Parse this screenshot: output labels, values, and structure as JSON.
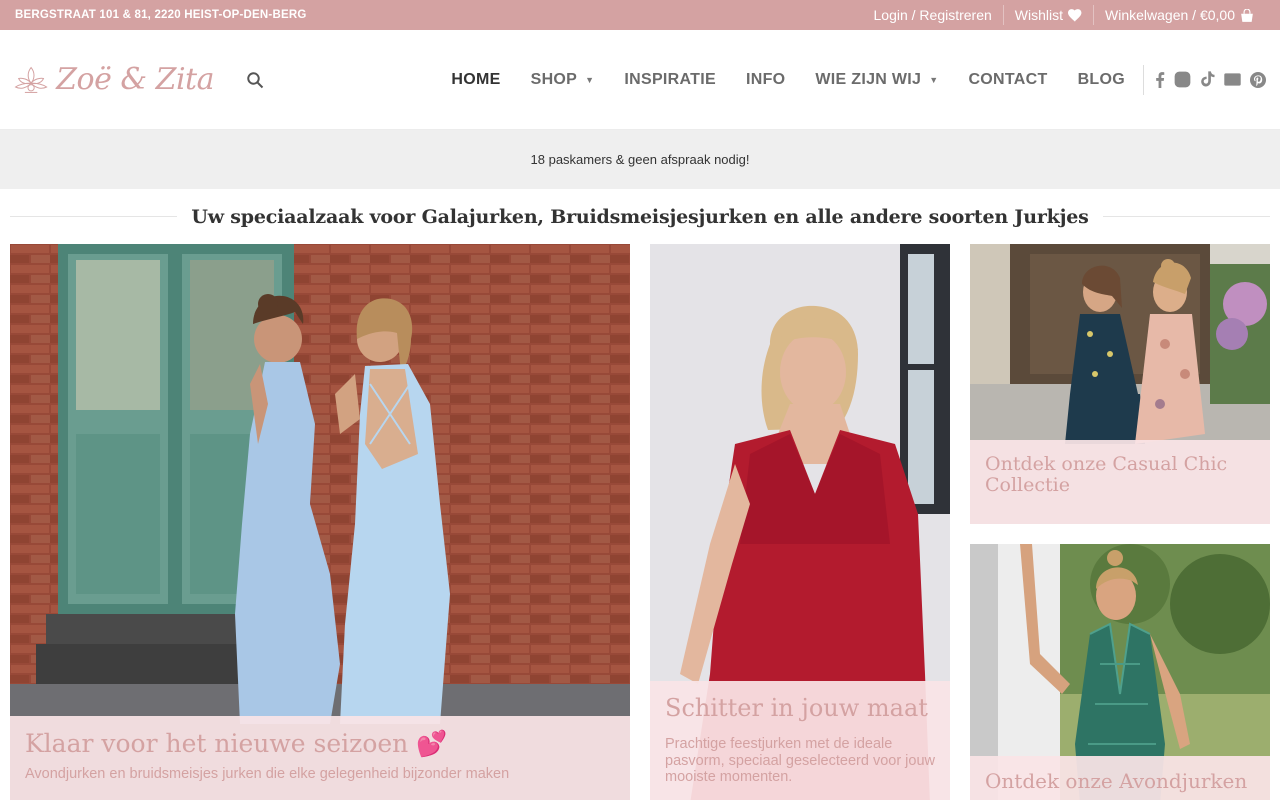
{
  "topbar": {
    "address": "BERGSTRAAT 101 & 81, 2220 HEIST-OP-DEN-BERG",
    "login": "Login / Registreren",
    "wishlist": "Wishlist",
    "cart": "Winkelwagen / €0,00"
  },
  "header": {
    "logo_text": "Zoë & Zita",
    "nav": [
      {
        "label": "HOME",
        "active": true
      },
      {
        "label": "SHOP",
        "dropdown": true
      },
      {
        "label": "INSPIRATIE"
      },
      {
        "label": "INFO"
      },
      {
        "label": "WIE ZIJN WIJ",
        "dropdown": true
      },
      {
        "label": "CONTACT"
      },
      {
        "label": "BLOG"
      }
    ],
    "social_icons": [
      "facebook-icon",
      "instagram-icon",
      "tiktok-icon",
      "mail-icon",
      "pinterest-icon"
    ]
  },
  "announcement": "18 paskamers & geen afspraak nodig!",
  "section_title": "Uw speciaalzaak voor Galajurken, Bruidsmeisjesjurken en alle andere soorten Jurkjes",
  "cards": [
    {
      "title": "Klaar voor het nieuwe seizoen 💕",
      "subtitle": "Avondjurken en bruidsmeisjes jurken die elke gelegenheid bijzonder maken"
    },
    {
      "title": "Schitter in jouw maat",
      "subtitle": "Prachtige feestjurken met de ideale pasvorm, speciaal geselecteerd voor jouw mooiste momenten."
    },
    {
      "title": "Ontdek onze Casual Chic Collectie"
    },
    {
      "title": "Ontdek onze Avondjurken"
    }
  ],
  "colors": {
    "brand_pink": "#d4a2a2",
    "caption_bg": "#fae4e6",
    "announce_bg": "#efefef"
  }
}
